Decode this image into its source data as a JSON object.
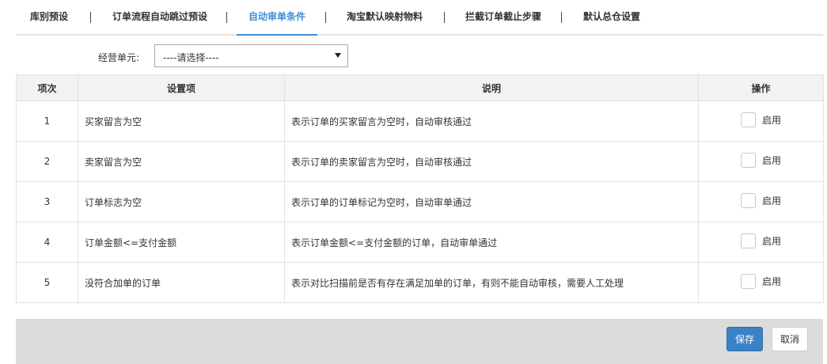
{
  "tabs": [
    {
      "label": "库别预设"
    },
    {
      "label": "订单流程自动跳过预设"
    },
    {
      "label": "自动审单条件",
      "active": true
    },
    {
      "label": "淘宝默认映射物料"
    },
    {
      "label": "拦截订单截止步骤"
    },
    {
      "label": "默认总仓设置"
    }
  ],
  "filter": {
    "label": "经营单元:",
    "value": "----请选择----"
  },
  "table": {
    "headers": [
      "项次",
      "设置项",
      "说明",
      "操作"
    ],
    "rows": [
      {
        "idx": "1",
        "item": "买家留言为空",
        "desc": "表示订单的买家留言为空时，自动审核通过",
        "op_label": "启用",
        "checked": false
      },
      {
        "idx": "2",
        "item": "卖家留言为空",
        "desc": "表示订单的卖家留言为空时，自动审核通过",
        "op_label": "启用",
        "checked": false
      },
      {
        "idx": "3",
        "item": "订单标志为空",
        "desc": "表示订单的订单标记为空时，自动审单通过",
        "op_label": "启用",
        "checked": false
      },
      {
        "idx": "4",
        "item": "订单金额<=支付金额",
        "desc": "表示订单金额<=支付金额的订单，自动审单通过",
        "op_label": "启用",
        "checked": false
      },
      {
        "idx": "5",
        "item": "没符合加单的订单",
        "desc": "表示对比扫描前是否有存在满足加单的订单，有则不能自动审核，需要人工处理",
        "op_label": "启用",
        "checked": false
      }
    ]
  },
  "footer": {
    "save_label": "保存",
    "cancel_label": "取消"
  },
  "colors": {
    "accent": "#3e8fd4",
    "save_button": "#3a82c4"
  }
}
